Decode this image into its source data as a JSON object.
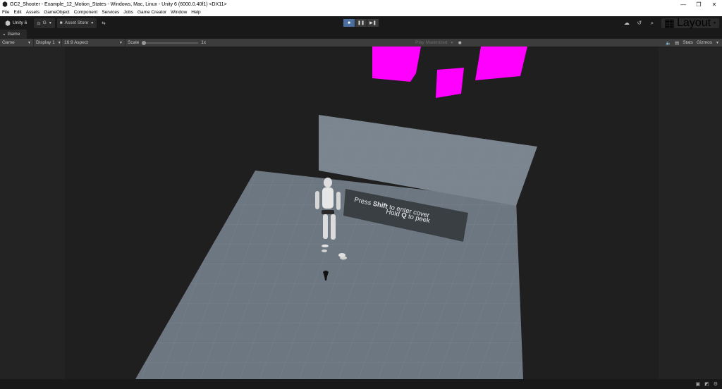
{
  "window": {
    "title": "GC2_Shooter - Example_12_Motion_States - Windows, Mac, Linux - Unity 6 (6000.0.40f1) <DX11>",
    "minimize": "—",
    "maximize": "❐",
    "close": "✕"
  },
  "menu": [
    "File",
    "Edit",
    "Assets",
    "GameObject",
    "Component",
    "Services",
    "Jobs",
    "Game Creator",
    "Window",
    "Help"
  ],
  "toolbar": {
    "unity_label": "Unity 6",
    "account": "G",
    "asset_store": "Asset Store",
    "layout": "Layout"
  },
  "tab": {
    "label": "Game"
  },
  "gamebar": {
    "mode": "Game",
    "display": "Display 1",
    "aspect": "16:9 Aspect",
    "scale_label": "Scale",
    "scale_value": "1x",
    "play_mode": "Play Maximized",
    "stats": "Stats",
    "gizmos": "Gizmos"
  },
  "scene": {
    "sign_line1_a": "Press ",
    "sign_line1_b": "Shift",
    "sign_line1_c": " to enter cover",
    "sign_line2_a": "Hold ",
    "sign_line2_b": "Q",
    "sign_line2_c": " to peek",
    "colors": {
      "cube": "#ff00ff",
      "floor": "#6d7781",
      "wall": "#7b858f",
      "sign": "#3a3f44"
    }
  }
}
